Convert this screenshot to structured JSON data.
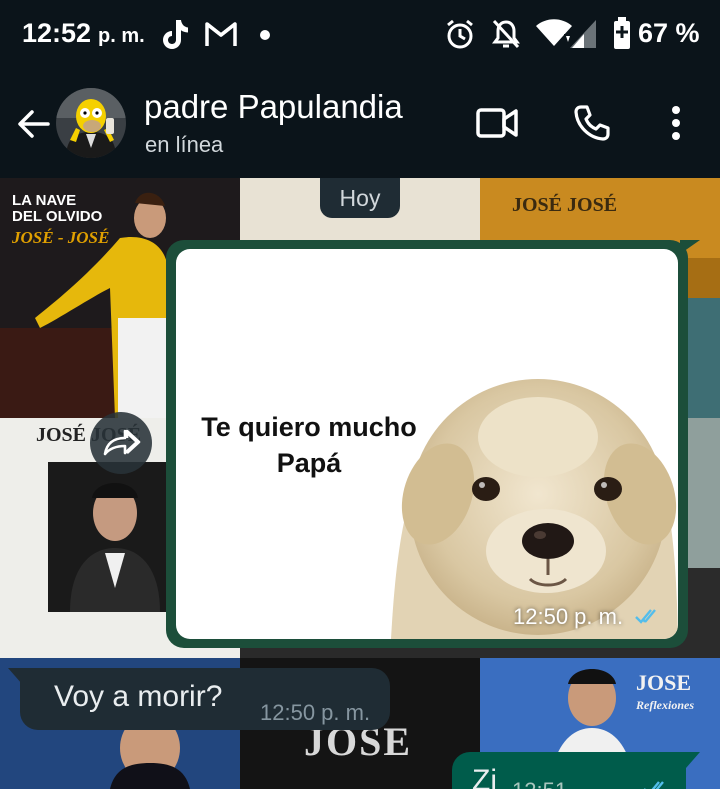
{
  "status_bar": {
    "time": "12:52",
    "ampm": "p. m.",
    "notification_icons": [
      "tiktok-icon",
      "gmail-icon",
      "dot-icon"
    ],
    "system_icons": [
      "alarm-icon",
      "bell-off-icon",
      "wifi-icon",
      "signal-icon",
      "battery-icon"
    ],
    "battery_percent": "67 %"
  },
  "header": {
    "contact_name": "padre Papulandia",
    "contact_status": "en línea",
    "buttons": [
      "back-arrow-icon",
      "video-call-icon",
      "voice-call-icon",
      "more-options-icon"
    ]
  },
  "wallpaper": {
    "tiles": [
      {
        "title": "LA NAVE",
        "subtitle": "DEL OLVIDO",
        "artist": "JOSÉ - JOSÉ"
      },
      {
        "artist": "JOSÉ JOSÉ"
      },
      {
        "artist": "JOSÉ JOSÉ"
      },
      {
        "artist": "JOSE"
      },
      {
        "artist": "JOSE",
        "subtitle": "Reflexiones"
      }
    ]
  },
  "date_chip": "Hoy",
  "messages": [
    {
      "type": "image",
      "direction": "outgoing",
      "caption_line1": "Te quiero mucho",
      "caption_line2": "Papá",
      "time": "12:50 p. m.",
      "status": "read"
    },
    {
      "type": "text",
      "direction": "incoming",
      "text": "Voy a morir?",
      "time": "12:50 p. m."
    },
    {
      "type": "text",
      "direction": "outgoing",
      "text": "Zi",
      "time": "12:51",
      "status": "read"
    }
  ],
  "colors": {
    "background": "#0b141a",
    "incoming_bubble": "#1f2c34",
    "outgoing_bubble": "#005c4b",
    "image_bubble_border": "#1c4e3a",
    "read_ticks": "#53bdeb"
  }
}
